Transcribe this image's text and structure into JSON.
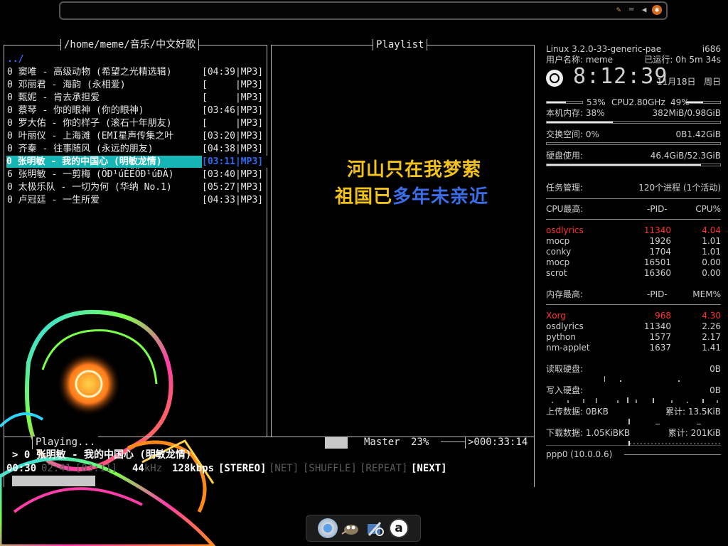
{
  "tray": {
    "icons": [
      "tools-icon",
      "keyboard-icon",
      "volume-icon",
      "weather-icon"
    ]
  },
  "moc": {
    "dir_title": "/home/meme/音乐/中文好歌",
    "playlist_title": "Playlist",
    "parent_dir": "../",
    "files": [
      {
        "name": "0 窦唯 - 高级动物 (希望之光精选辑)",
        "dur": "[04:39|MP3]"
      },
      {
        "name": "0 邓丽君 - 海韵 (永相爱)",
        "dur": "[     |MP3]"
      },
      {
        "name": "0 甄妮 - 肯去承担爱",
        "dur": "[     |MP3]"
      },
      {
        "name": "0 蔡琴 - 你的眼神 (你的眼神)",
        "dur": "[03:46|MP3]"
      },
      {
        "name": "0 罗大佑 - 你的样子 (滚石十年朋友)",
        "dur": "[     |MP3]"
      },
      {
        "name": "0 叶丽仪 - 上海滩 (EMI星声传集之叶",
        "dur": "[03:20|MP3]"
      },
      {
        "name": "0 齐秦 - 往事随风 (永远的朋友)",
        "dur": "[04:38|MP3]"
      },
      {
        "name": "0 张明敏 - 我的中国心 (明敏龙情)",
        "dur": "[03:11|MP3]"
      },
      {
        "name": "6 张明敏 - 一剪梅 (ÖÐ¹úÈËÖÐ¹úÐÄ)",
        "dur": "[03:40|MP3]"
      },
      {
        "name": "0 太极乐队 - 一切为何 (华纳 No.1)",
        "dur": "[05:27|MP3]"
      },
      {
        "name": "0 卢冠廷 - 一生所爱",
        "dur": "[04:33|MP3]"
      }
    ],
    "selected_index": 7,
    "state": "Playing...",
    "mixer_label": "Master",
    "mixer_value": "23%",
    "total_time": ">000:33:14",
    "now_playing": "> 0 张明敏 - 我的中国心 (明敏龙情)",
    "time_elapsed": "00:30",
    "time_left": "02:41",
    "time_total": "[03:11]",
    "rate": "44",
    "rate_unit": "kHz",
    "bitrate": "128kbps",
    "flags": {
      "stereo": "[STEREO]",
      "net": "[NET]",
      "shuffle": "[SHUFFLE]",
      "repeat": "[REPEAT]",
      "next": "[NEXT]"
    },
    "progress": 0.16
  },
  "lyrics": {
    "line1": "河山只在我梦萦",
    "line2_a": "祖国已",
    "line2_b": "多年未亲近"
  },
  "conky": {
    "kernel": "Linux 3.2.0-33-generic-pae",
    "arch": "i686",
    "user_label": "用户名称: meme",
    "uptime": "已运行: 0h 5m 34s",
    "clock": "8:12:39",
    "date": "11月18日",
    "weekday": "周日",
    "cpu1": "53%",
    "cpu_label": "CPU2.80GHz",
    "cpu2": "49%",
    "mem_label": "本机内存: 38%",
    "mem_value": "382MiB/0.98GiB",
    "swap_label": "交换空间: 0%",
    "swap_value": "0B1.42GiB",
    "disk_label": "硬盘使用:",
    "disk_value": "46.4GiB/52.3GiB",
    "task_label": "任务管理:",
    "task_value": "120个进程 (1个活动)",
    "cpu_top": {
      "label": "CPU最高:",
      "pid": "-PID-",
      "col": "CPU%",
      "rows": [
        {
          "name": "osdlyrics",
          "pid": "11340",
          "val": "4.04"
        },
        {
          "name": "mocp",
          "pid": "1926",
          "val": "1.01"
        },
        {
          "name": "conky",
          "pid": "1704",
          "val": "1.01"
        },
        {
          "name": "mocp",
          "pid": "16501",
          "val": "0.00"
        },
        {
          "name": "scrot",
          "pid": "16360",
          "val": "0.00"
        }
      ]
    },
    "mem_top": {
      "label": "内存最高:",
      "pid": "-PID-",
      "col": "MEM%",
      "rows": [
        {
          "name": "Xorg",
          "pid": "968",
          "val": "4.30"
        },
        {
          "name": "osdlyrics",
          "pid": "11340",
          "val": "2.26"
        },
        {
          "name": "python",
          "pid": "1577",
          "val": "2.17"
        },
        {
          "name": "nm-applet",
          "pid": "1637",
          "val": "1.41"
        }
      ]
    },
    "disk_read_label": "读取硬盘:",
    "disk_read_value": "0B",
    "disk_write_label": "写入硬盘:",
    "disk_write_value": "0B",
    "upload_label": "上传数据: 0BKB",
    "upload_total": "累计: 13.5KiB",
    "download_label": "下载数据: 1.05KiBKB",
    "download_total": "累计: 201KiB",
    "iface": "ppp0 (10.0.0.6)",
    "bars": {
      "cpu1": 0.53,
      "cpu2": 0.49,
      "mem": 0.38,
      "swap": 0.0,
      "disk": 0.89
    }
  },
  "dock": {
    "icons": [
      "chromium-icon",
      "gimp-icon",
      "system-tools-icon",
      "amarok-icon"
    ]
  }
}
